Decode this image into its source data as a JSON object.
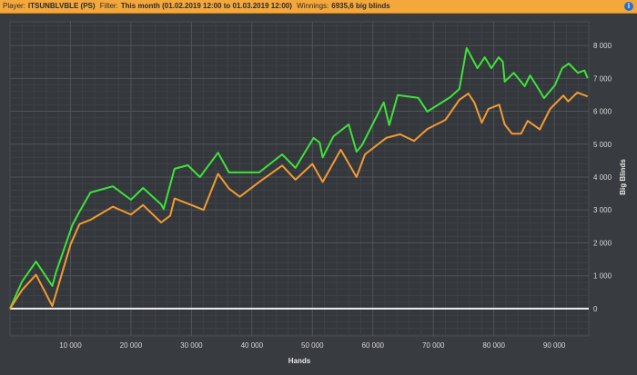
{
  "header": {
    "player_label": "Player:",
    "player_value": "ITSUNBLVBLE (PS)",
    "filter_label": "Filter:",
    "filter_value": "This month (01.02.2019 12:00 to 01.03.2019 12:00)",
    "winnings_label": "Winnings:",
    "winnings_value": "6935,6 big blinds",
    "info_icon": "i"
  },
  "colors": {
    "header_bg": "#f4a83c",
    "plot_bg": "#34373b",
    "series_green": "#3ee23a",
    "series_orange": "#f29a33",
    "zero_line": "#f0f0f0"
  },
  "chart_data": {
    "type": "line",
    "xlabel": "Hands",
    "ylabel": "Big Blinds",
    "xlim": [
      0,
      95700
    ],
    "ylim": [
      -830,
      8720
    ],
    "grid": true,
    "x_ticks": [
      10000,
      20000,
      30000,
      40000,
      50000,
      60000,
      70000,
      80000,
      90000
    ],
    "x_tick_labels": [
      "10 000",
      "20 000",
      "30 000",
      "40 000",
      "50 000",
      "60 000",
      "70 000",
      "80 000",
      "90 000"
    ],
    "y_ticks": [
      0,
      1000,
      2000,
      3000,
      4000,
      5000,
      6000,
      7000,
      8000
    ],
    "y_tick_labels": [
      "0",
      "1 000",
      "2 000",
      "3 000",
      "4 000",
      "5 000",
      "6 000",
      "7 000",
      "8 000"
    ],
    "series": [
      {
        "color": "#3ee23a",
        "points": [
          [
            0,
            0
          ],
          [
            2000,
            830
          ],
          [
            4300,
            1430
          ],
          [
            7000,
            690
          ],
          [
            7600,
            1100
          ],
          [
            10300,
            2540
          ],
          [
            11500,
            2950
          ],
          [
            13300,
            3530
          ],
          [
            17000,
            3720
          ],
          [
            20000,
            3310
          ],
          [
            22000,
            3670
          ],
          [
            25000,
            3170
          ],
          [
            25400,
            3030
          ],
          [
            27200,
            4250
          ],
          [
            29400,
            4360
          ],
          [
            31400,
            4000
          ],
          [
            34400,
            4740
          ],
          [
            36200,
            4140
          ],
          [
            41200,
            4140
          ],
          [
            45000,
            4690
          ],
          [
            47200,
            4280
          ],
          [
            50200,
            5190
          ],
          [
            51200,
            5050
          ],
          [
            51700,
            4600
          ],
          [
            53500,
            5240
          ],
          [
            56000,
            5600
          ],
          [
            57300,
            4770
          ],
          [
            58200,
            4970
          ],
          [
            61800,
            6270
          ],
          [
            62700,
            5580
          ],
          [
            64100,
            6490
          ],
          [
            67500,
            6410
          ],
          [
            69000,
            5990
          ],
          [
            72800,
            6430
          ],
          [
            74300,
            6680
          ],
          [
            75500,
            7920
          ],
          [
            77300,
            7310
          ],
          [
            78500,
            7640
          ],
          [
            79600,
            7310
          ],
          [
            80800,
            7640
          ],
          [
            81500,
            7500
          ],
          [
            81800,
            6900
          ],
          [
            83300,
            7170
          ],
          [
            85100,
            6760
          ],
          [
            86000,
            7090
          ],
          [
            87600,
            6620
          ],
          [
            88300,
            6400
          ],
          [
            90100,
            6790
          ],
          [
            91300,
            7310
          ],
          [
            92400,
            7450
          ],
          [
            93900,
            7170
          ],
          [
            95000,
            7240
          ],
          [
            95500,
            7010
          ]
        ]
      },
      {
        "color": "#f29a33",
        "points": [
          [
            0,
            0
          ],
          [
            2000,
            570
          ],
          [
            4300,
            1030
          ],
          [
            7000,
            80
          ],
          [
            10000,
            1950
          ],
          [
            11500,
            2570
          ],
          [
            13300,
            2700
          ],
          [
            17000,
            3100
          ],
          [
            20000,
            2860
          ],
          [
            22000,
            3150
          ],
          [
            25000,
            2620
          ],
          [
            26500,
            2830
          ],
          [
            27200,
            3350
          ],
          [
            30000,
            3150
          ],
          [
            32000,
            3000
          ],
          [
            34400,
            4100
          ],
          [
            36200,
            3650
          ],
          [
            38000,
            3400
          ],
          [
            41200,
            3850
          ],
          [
            45000,
            4350
          ],
          [
            47200,
            3920
          ],
          [
            50000,
            4400
          ],
          [
            51700,
            3850
          ],
          [
            54700,
            4830
          ],
          [
            57300,
            4000
          ],
          [
            58700,
            4690
          ],
          [
            62200,
            5190
          ],
          [
            64500,
            5300
          ],
          [
            66800,
            5100
          ],
          [
            69000,
            5460
          ],
          [
            72000,
            5740
          ],
          [
            74300,
            6350
          ],
          [
            75800,
            6540
          ],
          [
            76800,
            6260
          ],
          [
            78000,
            5650
          ],
          [
            79100,
            6070
          ],
          [
            80900,
            6200
          ],
          [
            81800,
            5600
          ],
          [
            83000,
            5320
          ],
          [
            84500,
            5320
          ],
          [
            85600,
            5710
          ],
          [
            87600,
            5450
          ],
          [
            89300,
            6070
          ],
          [
            91500,
            6480
          ],
          [
            92300,
            6300
          ],
          [
            93800,
            6570
          ],
          [
            95500,
            6450
          ]
        ]
      }
    ]
  }
}
